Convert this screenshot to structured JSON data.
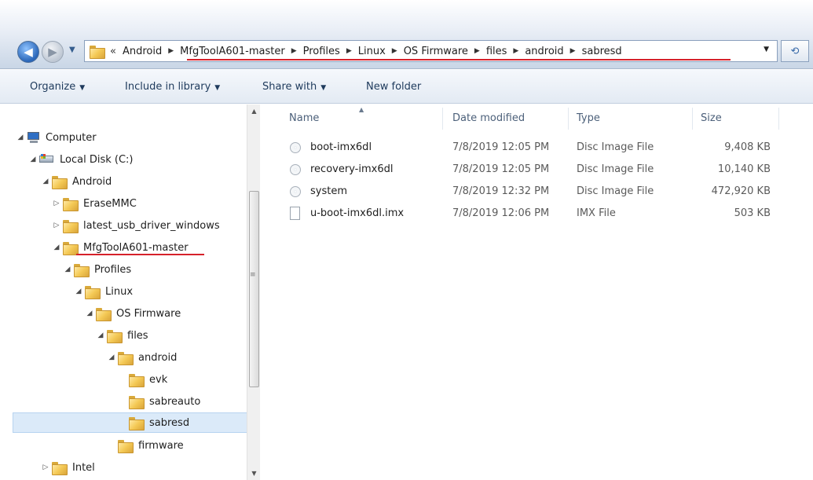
{
  "address": {
    "overflow": "«",
    "crumbs": [
      "Android",
      "MfgToolA601-master",
      "Profiles",
      "Linux",
      "OS Firmware",
      "files",
      "android",
      "sabresd"
    ]
  },
  "toolbar": {
    "organize": "Organize",
    "include": "Include in library",
    "share": "Share with",
    "new_folder": "New folder"
  },
  "tree": {
    "computer": "Computer",
    "local_disk": "Local Disk (C:)",
    "android": "Android",
    "erasemmc": "EraseMMC",
    "latest_usb": "latest_usb_driver_windows",
    "mfgtool": "MfgToolA601-master",
    "profiles": "Profiles",
    "linux": "Linux",
    "os_firmware": "OS Firmware",
    "files": "files",
    "android_sub": "android",
    "evk": "evk",
    "sabreauto": "sabreauto",
    "sabresd": "sabresd",
    "firmware": "firmware",
    "intel": "Intel"
  },
  "columns": {
    "name": "Name",
    "date": "Date modified",
    "type": "Type",
    "size": "Size"
  },
  "files": [
    {
      "name": "boot-imx6dl",
      "date": "7/8/2019 12:05 PM",
      "type": "Disc Image File",
      "size": "9,408 KB"
    },
    {
      "name": "recovery-imx6dl",
      "date": "7/8/2019 12:05 PM",
      "type": "Disc Image File",
      "size": "10,140 KB"
    },
    {
      "name": "system",
      "date": "7/8/2019 12:32 PM",
      "type": "Disc Image File",
      "size": "472,920 KB"
    },
    {
      "name": "u-boot-imx6dl.imx",
      "date": "7/8/2019 12:06 PM",
      "type": "IMX File",
      "size": "503 KB"
    }
  ],
  "colors": {
    "highlight_underline": "#d6212a",
    "selection": "#dbeaf9"
  }
}
